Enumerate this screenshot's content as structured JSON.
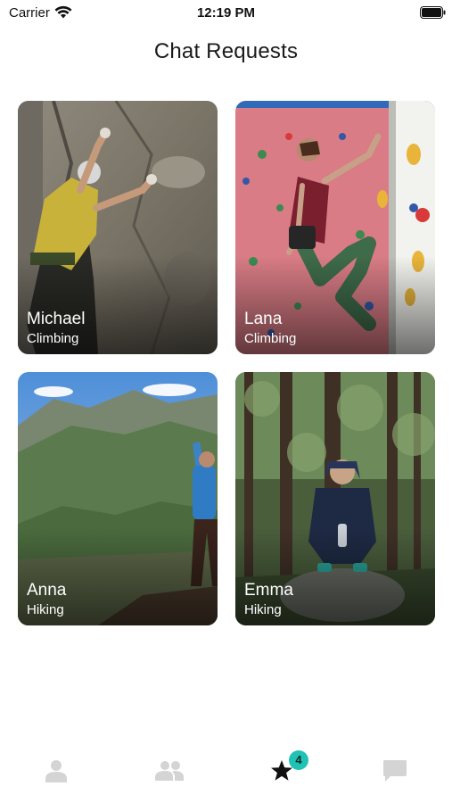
{
  "status_bar": {
    "carrier": "Carrier",
    "time": "12:19 PM"
  },
  "page": {
    "title": "Chat Requests"
  },
  "cards": [
    {
      "name": "Michael",
      "activity": "Climbing"
    },
    {
      "name": "Lana",
      "activity": "Climbing"
    },
    {
      "name": "Anna",
      "activity": "Hiking"
    },
    {
      "name": "Emma",
      "activity": "Hiking"
    }
  ],
  "tab_bar": {
    "tabs": [
      {
        "icon": "person-icon",
        "active": false
      },
      {
        "icon": "people-icon",
        "active": false
      },
      {
        "icon": "star-icon",
        "active": true,
        "badge": "4"
      },
      {
        "icon": "chat-bubble-icon",
        "active": false
      }
    ],
    "colors": {
      "inactive": "#d4d4d4",
      "active": "#111111",
      "badge": "#1fc2b4"
    }
  }
}
